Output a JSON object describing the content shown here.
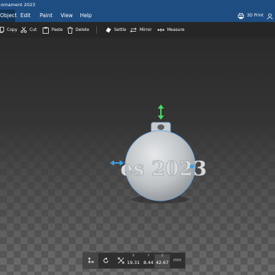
{
  "window": {
    "title": "ornament 2023"
  },
  "menu": {
    "items": [
      {
        "label": "Object",
        "active": true
      },
      {
        "label": "Edit"
      },
      {
        "label": "Paint"
      },
      {
        "label": "View"
      },
      {
        "label": "Help"
      }
    ],
    "right": {
      "print_label": "3D Print",
      "user_icon": "user-icon"
    }
  },
  "toolbar": {
    "items": [
      {
        "label": "Copy",
        "icon": "copy-icon"
      },
      {
        "label": "Cut",
        "icon": "scissors-icon"
      },
      {
        "label": "Paste",
        "icon": "paste-icon"
      },
      {
        "label": "Delete",
        "icon": "trash-icon"
      },
      {
        "label": "Settle",
        "icon": "settle-icon"
      },
      {
        "label": "Mirror",
        "icon": "mirror-icon"
      },
      {
        "label": "Measure",
        "icon": "measure-icon"
      }
    ]
  },
  "model": {
    "text": "es 2023"
  },
  "transform": {
    "x_label": "X",
    "x": "19.31",
    "y_label": "Y",
    "y": "8.44",
    "z_label": "Z",
    "z": "42.67",
    "unit": "mm"
  },
  "colors": {
    "title_bar": "#1e4d82",
    "toolbar": "#262626",
    "gizmo_green": "#4cd964",
    "gizmo_blue": "#3aa0e8",
    "selection": "#6ea8e0"
  }
}
